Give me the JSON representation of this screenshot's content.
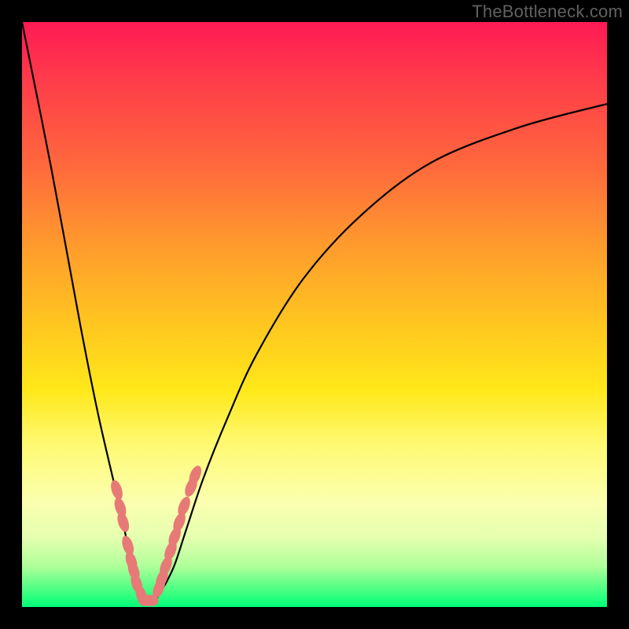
{
  "watermark": "TheBottleneck.com",
  "chart_data": {
    "type": "line",
    "title": "",
    "xlabel": "",
    "ylabel": "",
    "xlim": [
      0,
      100
    ],
    "ylim": [
      0,
      100
    ],
    "grid": false,
    "legend": false,
    "series": [
      {
        "name": "bottleneck-curve",
        "x": [
          0,
          5,
          10,
          13,
          16,
          18,
          19,
          20,
          21,
          22,
          23,
          24,
          26,
          28,
          31,
          35,
          40,
          48,
          58,
          70,
          85,
          100
        ],
        "y": [
          100,
          75,
          48,
          33,
          20,
          11,
          7,
          4,
          2,
          1,
          1.5,
          3,
          7,
          13,
          22,
          32,
          43,
          56,
          67,
          76,
          82,
          86
        ],
        "style": "curve"
      },
      {
        "name": "left-markers",
        "style": "markers",
        "points": [
          {
            "x": 16.2,
            "y": 20.0
          },
          {
            "x": 16.8,
            "y": 17.0
          },
          {
            "x": 17.3,
            "y": 14.5
          },
          {
            "x": 18.1,
            "y": 10.5
          },
          {
            "x": 18.7,
            "y": 7.8
          },
          {
            "x": 19.1,
            "y": 6.2
          },
          {
            "x": 19.6,
            "y": 4.0
          },
          {
            "x": 20.4,
            "y": 2.0
          }
        ]
      },
      {
        "name": "bottom-markers",
        "style": "pill",
        "points": [
          {
            "x": 20.7,
            "y": 1.2
          },
          {
            "x": 21.3,
            "y": 1.0
          },
          {
            "x": 21.9,
            "y": 1.0
          },
          {
            "x": 22.5,
            "y": 1.3
          }
        ]
      },
      {
        "name": "right-markers",
        "style": "markers",
        "points": [
          {
            "x": 23.4,
            "y": 3.2
          },
          {
            "x": 23.9,
            "y": 4.8
          },
          {
            "x": 24.6,
            "y": 7.0
          },
          {
            "x": 25.4,
            "y": 9.6
          },
          {
            "x": 26.1,
            "y": 12.0
          },
          {
            "x": 26.9,
            "y": 14.5
          },
          {
            "x": 27.7,
            "y": 17.2
          },
          {
            "x": 28.9,
            "y": 20.5
          },
          {
            "x": 29.6,
            "y": 22.5
          }
        ]
      }
    ]
  }
}
